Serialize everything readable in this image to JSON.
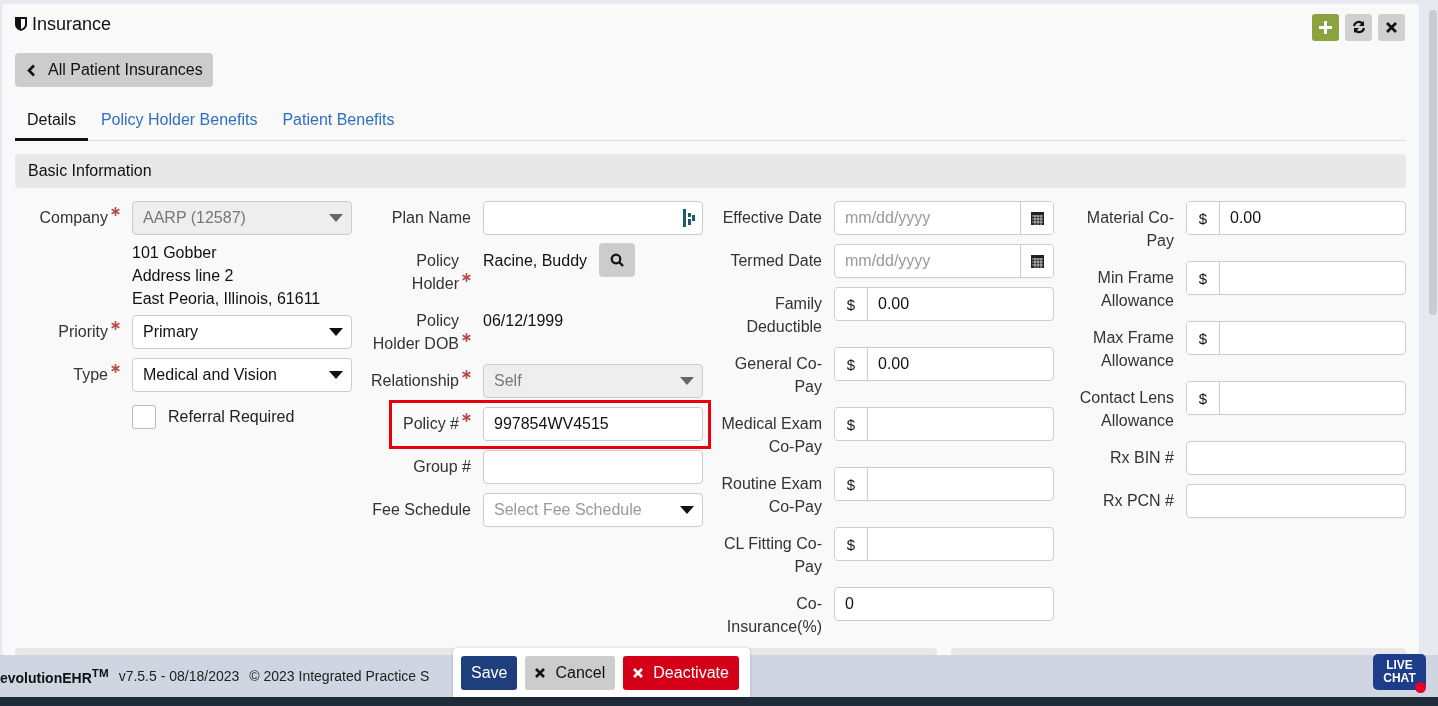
{
  "header": {
    "title": "Insurance"
  },
  "back_button": {
    "label": "All Patient Insurances"
  },
  "tabs": [
    {
      "label": "Details",
      "selected": true
    },
    {
      "label": "Policy Holder Benefits",
      "selected": false
    },
    {
      "label": "Patient Benefits",
      "selected": false
    }
  ],
  "section": {
    "title": "Basic Information"
  },
  "columns": [
    [
      {
        "kind": "select",
        "label": "Company",
        "required": true,
        "value": "AARP (12587)",
        "disabled": true
      },
      {
        "kind": "address",
        "lines": [
          "101 Gobber",
          "Address line 2",
          "East Peoria, Illinois, 61611"
        ]
      },
      {
        "kind": "select",
        "label": "Priority",
        "required": true,
        "value": "Primary",
        "disabled": false
      },
      {
        "kind": "select",
        "label": "Type",
        "required": true,
        "value": "Medical and Vision",
        "disabled": false
      },
      {
        "kind": "checkbox",
        "label": "Referral Required",
        "checked": false
      }
    ],
    [
      {
        "kind": "lookup",
        "label": "Plan Name",
        "required": false
      },
      {
        "kind": "search",
        "label": "Policy Holder",
        "required": true,
        "value": "Racine, Buddy"
      },
      {
        "kind": "static",
        "label": "Policy Holder DOB",
        "required": true,
        "value": "06/12/1999"
      },
      {
        "kind": "select",
        "label": "Relationship",
        "required": true,
        "value": "Self",
        "disabled": true
      },
      {
        "kind": "text",
        "label": "Policy #",
        "required": true,
        "value": "997854WV4515",
        "highlighted": true
      },
      {
        "kind": "text",
        "label": "Group #",
        "required": false
      },
      {
        "kind": "select",
        "label": "Fee Schedule",
        "required": false,
        "placeholder": "Select Fee Schedule",
        "disabled": false
      }
    ],
    [
      {
        "kind": "date",
        "label": "Effective Date",
        "placeholder": "mm/dd/yyyy"
      },
      {
        "kind": "date",
        "label": "Termed Date",
        "placeholder": "mm/dd/yyyy"
      },
      {
        "kind": "money",
        "label": "Family Deductible",
        "currency": "$",
        "value": "0.00"
      },
      {
        "kind": "money",
        "label": "General Co-Pay",
        "currency": "$",
        "value": "0.00"
      },
      {
        "kind": "money",
        "label": "Medical Exam Co-Pay",
        "currency": "$"
      },
      {
        "kind": "money",
        "label": "Routine Exam Co-Pay",
        "currency": "$"
      },
      {
        "kind": "money",
        "label": "CL Fitting Co-Pay",
        "currency": "$"
      },
      {
        "kind": "text",
        "label": "Co-Insurance(%)",
        "required": false,
        "value": "0"
      }
    ],
    [
      {
        "kind": "money",
        "label": "Material Co-Pay",
        "currency": "$",
        "value": "0.00"
      },
      {
        "kind": "money",
        "label": "Min Frame Allowance",
        "currency": "$"
      },
      {
        "kind": "money",
        "label": "Max Frame Allowance",
        "currency": "$"
      },
      {
        "kind": "money",
        "label": "Contact Lens Allowance",
        "currency": "$"
      },
      {
        "kind": "text",
        "label": "Rx BIN #",
        "required": false
      },
      {
        "kind": "text",
        "label": "Rx PCN #",
        "required": false
      }
    ]
  ],
  "footer": {
    "product": "evolutionEHR$^{TM}$",
    "version": "v7.5.5 - 08/18/2023",
    "copyright": "© 2023 Integrated Practice S"
  },
  "actions": [
    {
      "kind": "primary",
      "label": "Save"
    },
    {
      "kind": "cancel",
      "label": "Cancel"
    },
    {
      "kind": "danger",
      "label": "Deactivate"
    }
  ],
  "live_chat": {
    "label": "LIVE CHAT",
    "unread": true
  }
}
